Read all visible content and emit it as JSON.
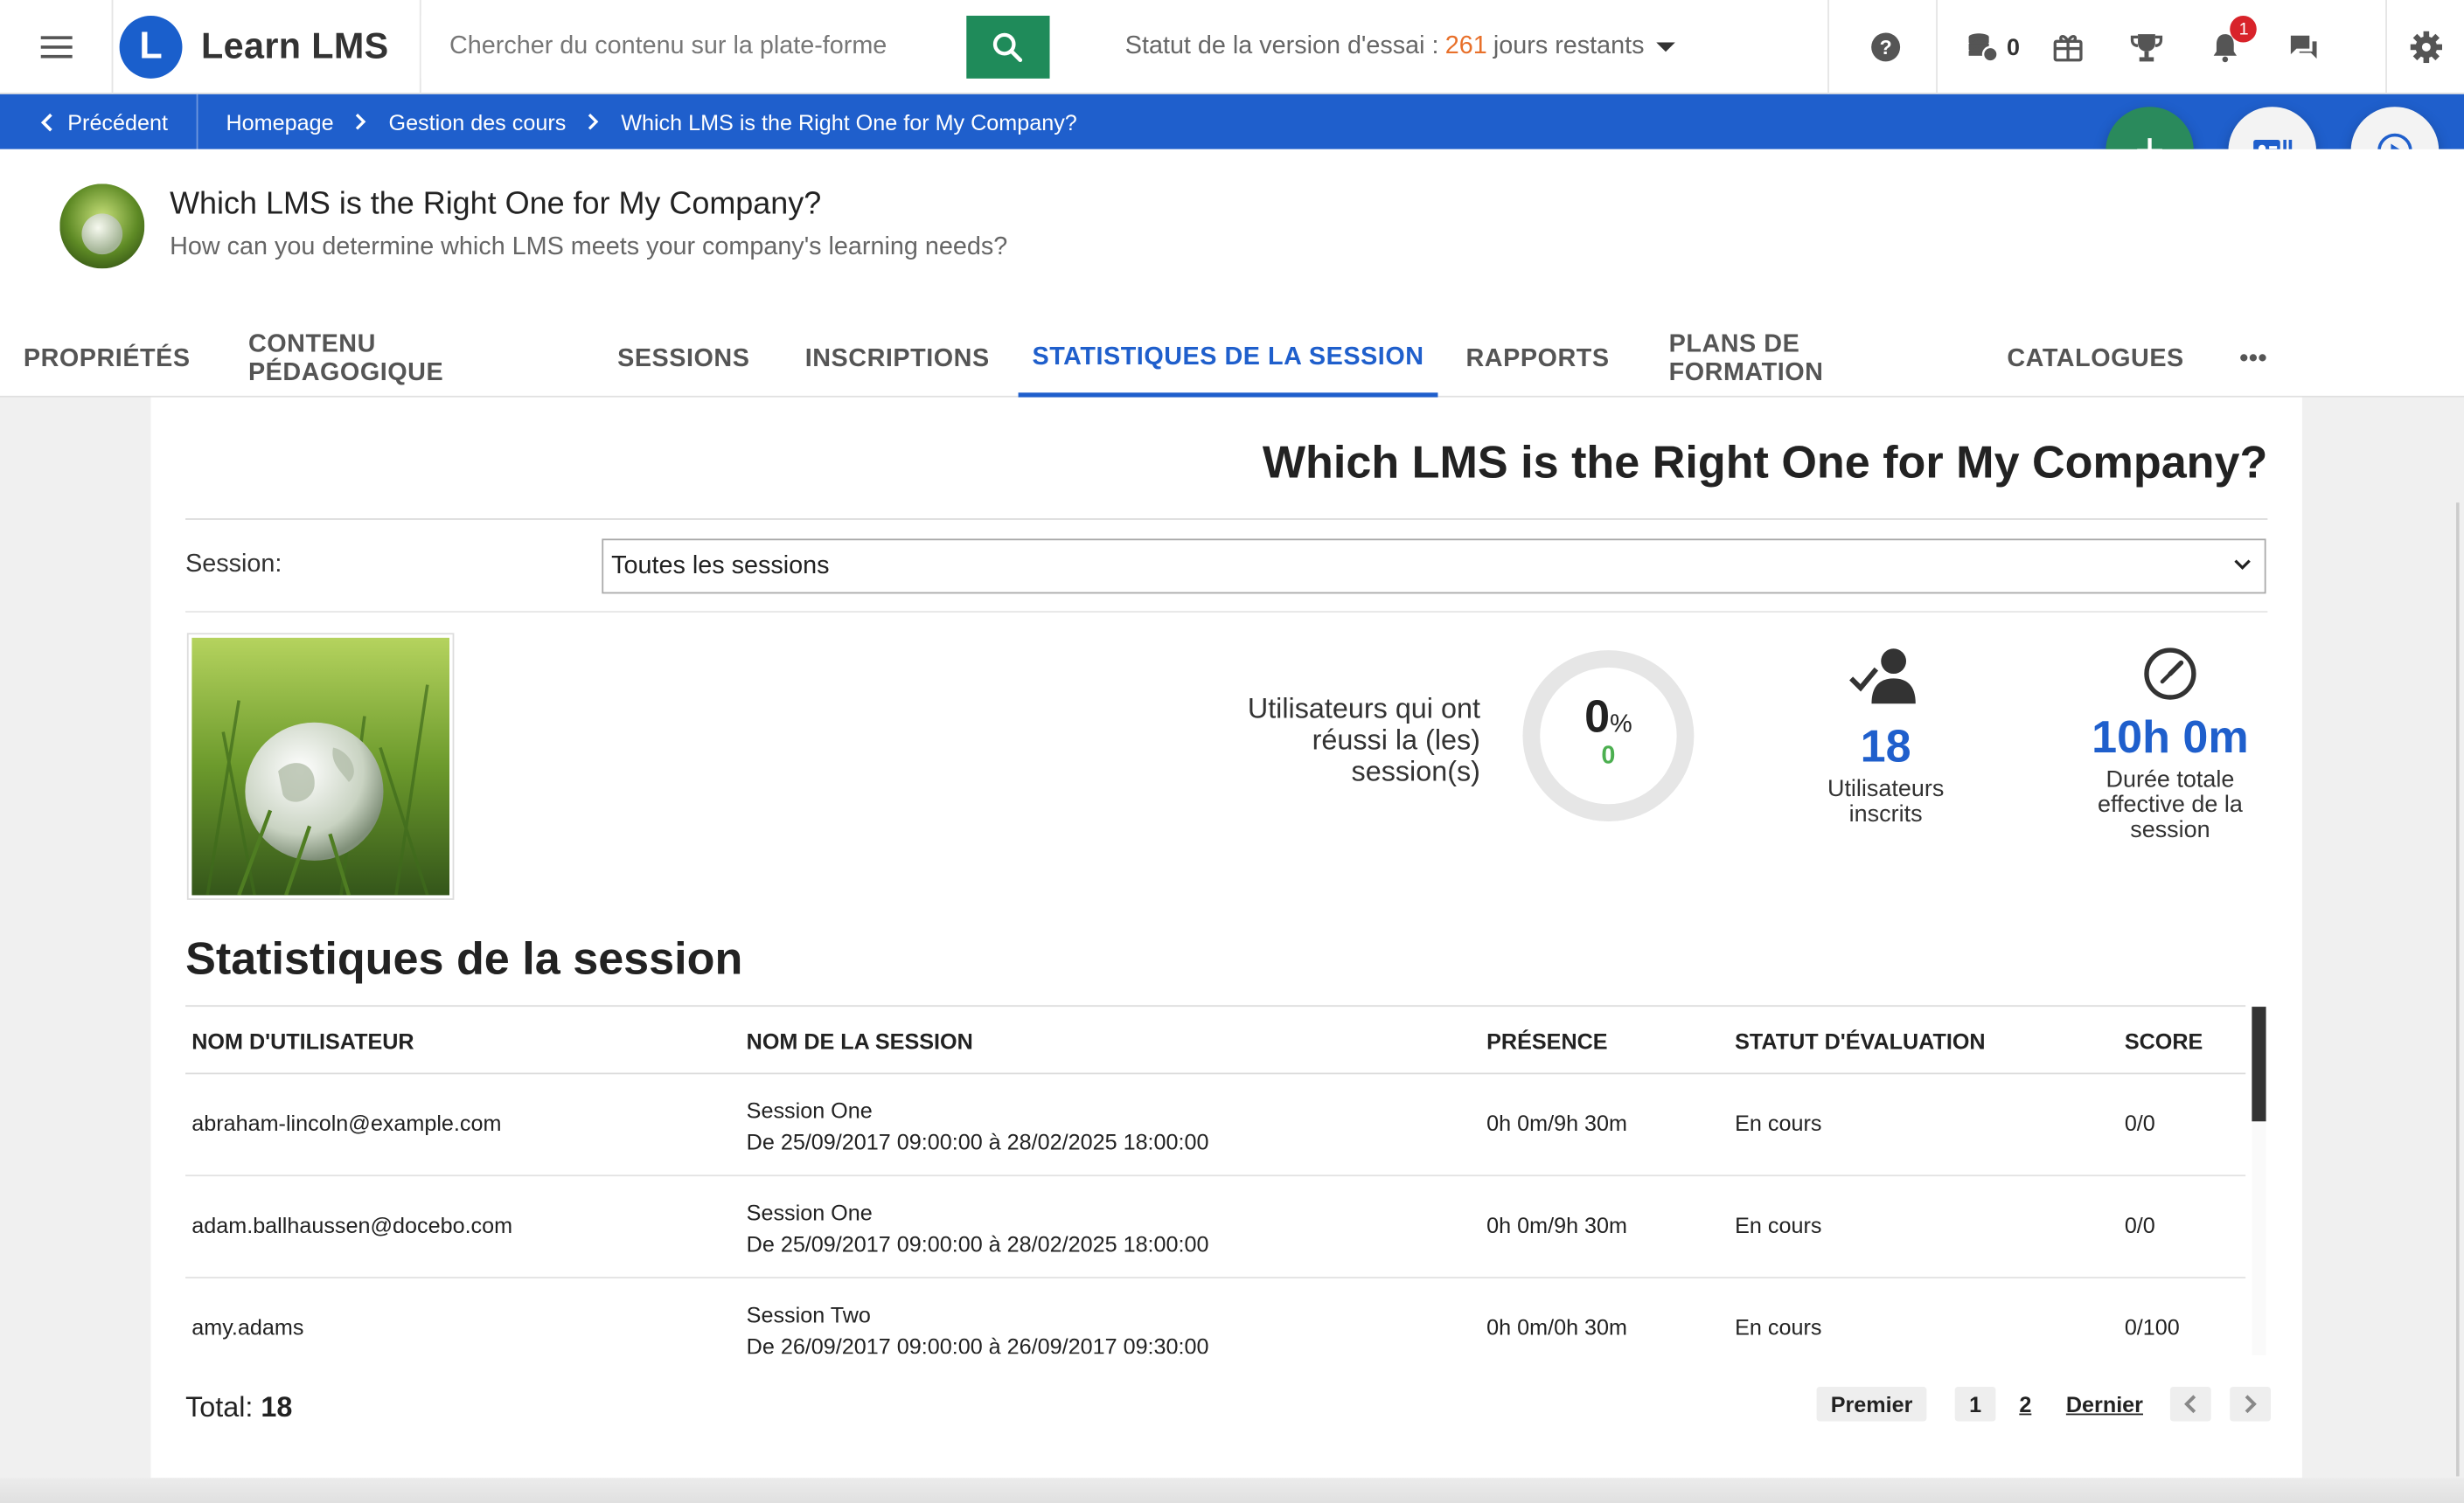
{
  "topbar": {
    "brand": "Learn LMS",
    "brand_initial": "L",
    "search_placeholder": "Chercher du contenu sur la plate-forme",
    "trial_prefix": "Statut de la version d'essai :",
    "trial_days": "261",
    "trial_suffix": "jours restants",
    "coins_count": "0",
    "notifications_count": "1"
  },
  "breadcrumb": {
    "back_label": "Précédent",
    "items": [
      "Homepage",
      "Gestion des cours",
      "Which LMS is the Right One for My Company?"
    ]
  },
  "course": {
    "title": "Which LMS is the Right One for My Company?",
    "subtitle": "How can you determine which LMS meets your company's learning needs?"
  },
  "tabs": [
    {
      "label": "PROPRIÉTÉS"
    },
    {
      "label": "CONTENU PÉDAGOGIQUE"
    },
    {
      "label": "SESSIONS"
    },
    {
      "label": "INSCRIPTIONS"
    },
    {
      "label": "STATISTIQUES DE LA SESSION",
      "active": true
    },
    {
      "label": "RAPPORTS"
    },
    {
      "label": "PLANS DE FORMATION"
    },
    {
      "label": "CATALOGUES"
    },
    {
      "label": "•••"
    }
  ],
  "panel": {
    "title": "Which LMS is the Right One for My Company?",
    "session_label": "Session:",
    "session_value": "Toutes les sessions",
    "passed_label": "Utilisateurs qui ont réussi la (les) session(s)",
    "passed_percent": "0",
    "percent_sign": "%",
    "passed_count": "0",
    "enrolled_count": "18",
    "enrolled_label": "Utilisateurs inscrits",
    "duration": "10h 0m",
    "duration_label": "Durée totale effective de la session",
    "section_title": "Statistiques de la session"
  },
  "table": {
    "headers": [
      "NOM D'UTILISATEUR",
      "NOM DE LA SESSION",
      "PRÉSENCE",
      "STATUT D'ÉVALUATION",
      "SCORE"
    ],
    "rows": [
      {
        "user": "abraham-lincoln@example.com",
        "session": "Session One",
        "dates": "De 25/09/2017 09:00:00 à 28/02/2025 18:00:00",
        "presence": "0h 0m/9h 30m",
        "status": "En cours",
        "score": "0/0"
      },
      {
        "user": "adam.ballhaussen@docebo.com",
        "session": "Session One",
        "dates": "De 25/09/2017 09:00:00 à 28/02/2025 18:00:00",
        "presence": "0h 0m/9h 30m",
        "status": "En cours",
        "score": "0/0"
      },
      {
        "user": "amy.adams",
        "session": "Session Two",
        "dates": "De 26/09/2017 09:00:00 à 26/09/2017 09:30:00",
        "presence": "0h 0m/0h 30m",
        "status": "En cours",
        "score": "0/100"
      }
    ]
  },
  "footer": {
    "total_label": "Total:",
    "total_value": "18",
    "pager_first": "Premier",
    "pager_pages": [
      "1",
      "2"
    ],
    "pager_last": "Dernier"
  },
  "colors": {
    "brand_blue": "#1f5fcc",
    "search_green": "#1f8b5a",
    "trial_orange": "#e8702a",
    "badge_red": "#d8232a",
    "success_green": "#4caf50"
  }
}
